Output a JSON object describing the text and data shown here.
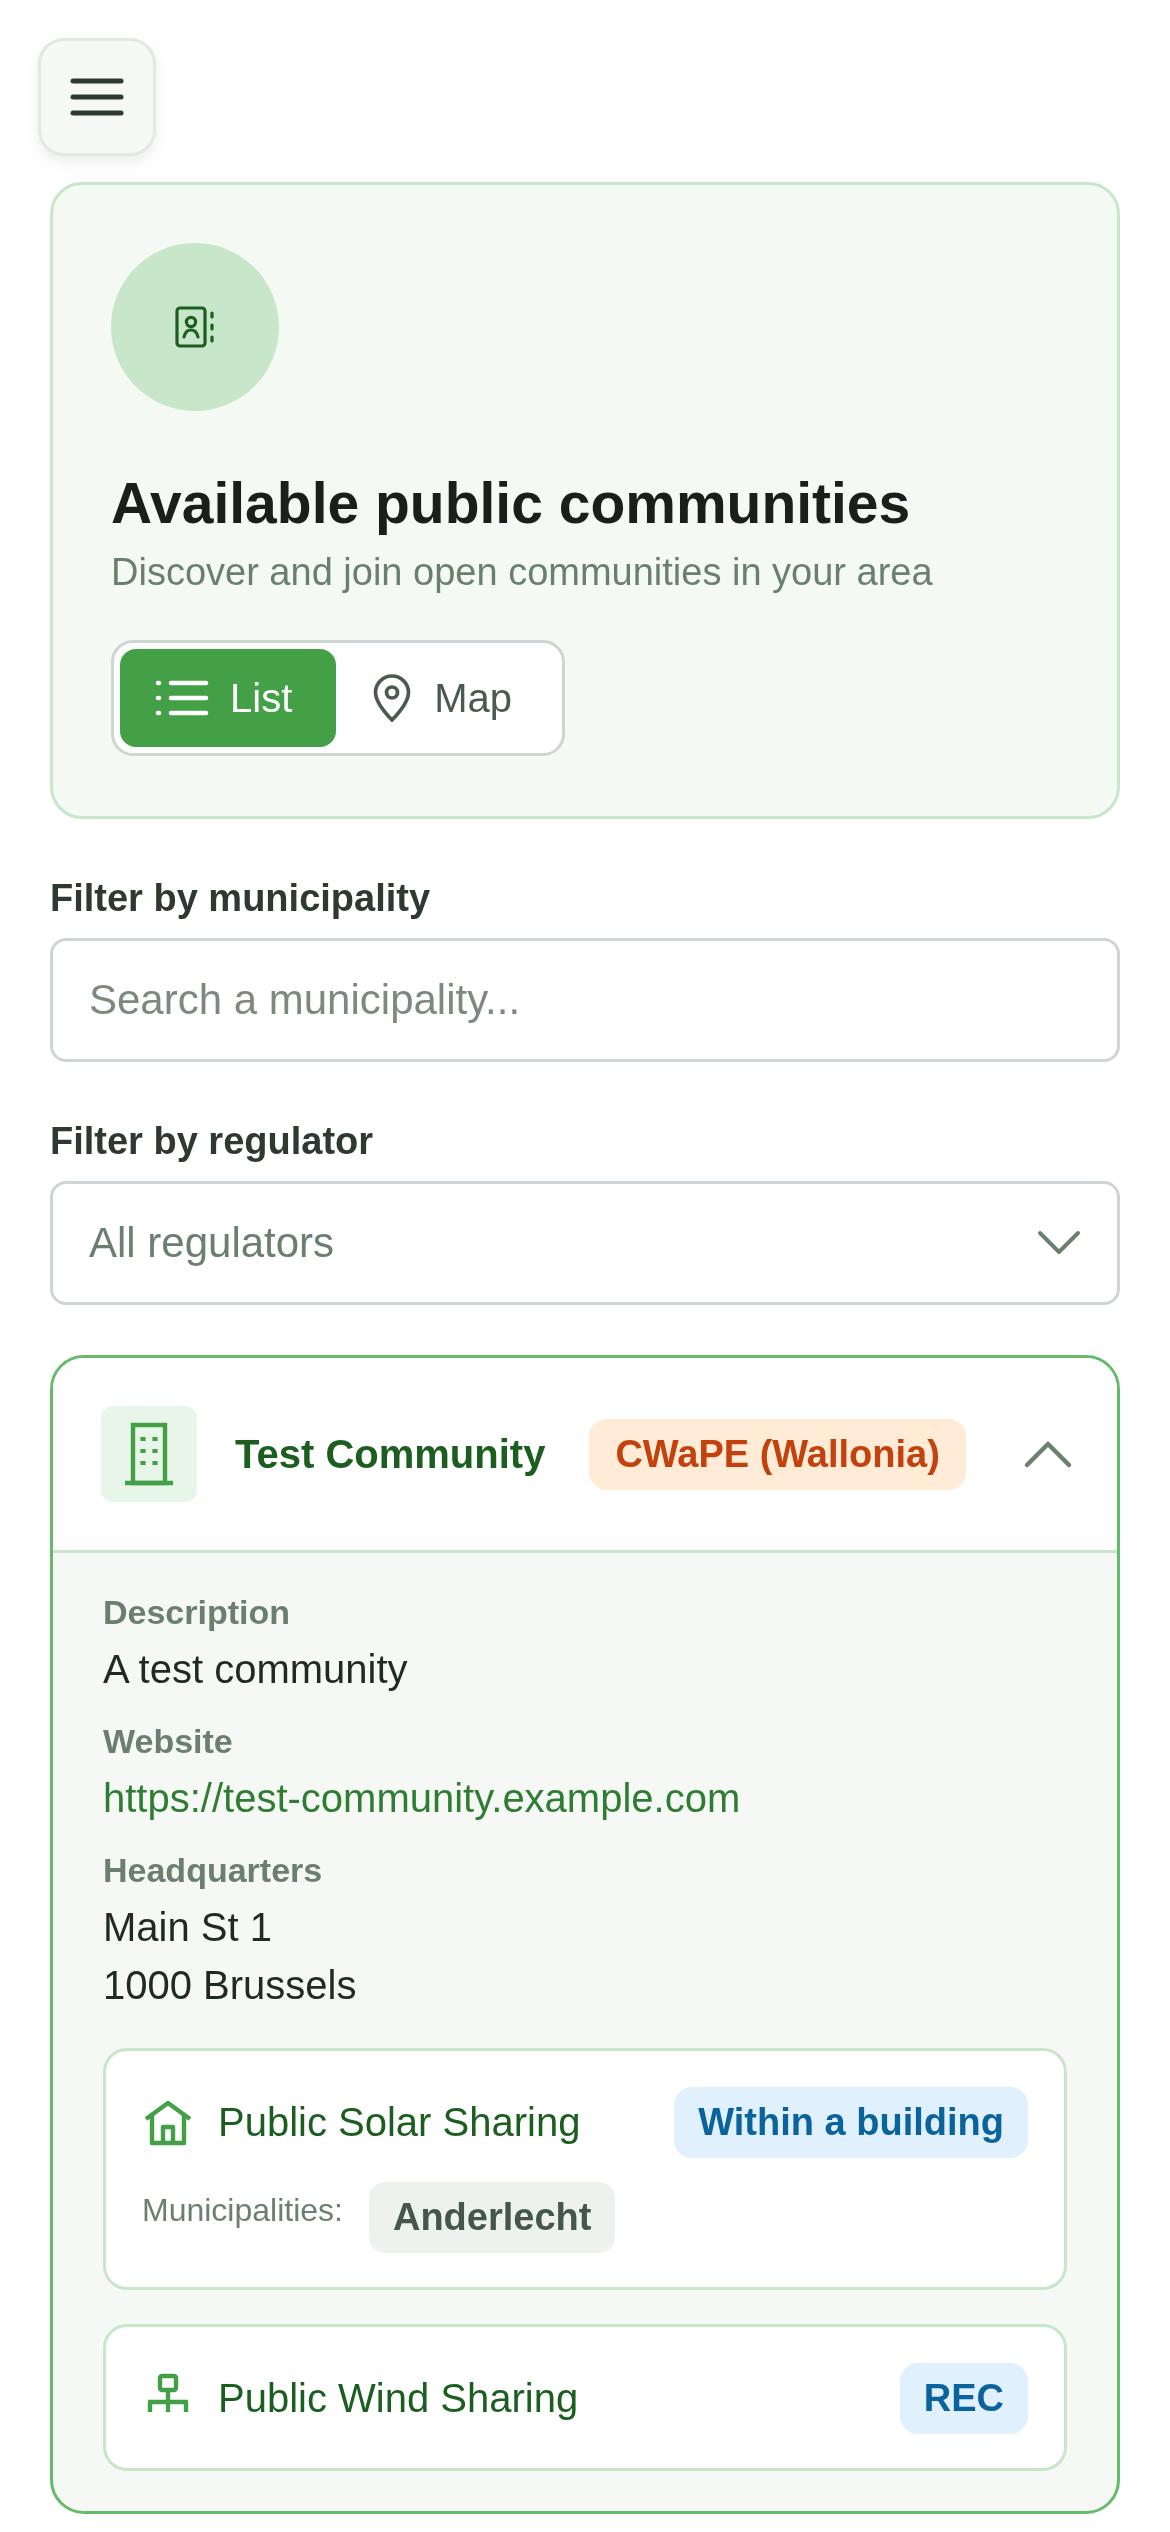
{
  "hero": {
    "title": "Available public communities",
    "subtitle": "Discover and join open communities in your area",
    "view_toggle": [
      {
        "label": "List",
        "selected": true
      },
      {
        "label": "Map",
        "selected": false
      }
    ]
  },
  "filters": [
    {
      "label": "Filter by municipality",
      "kind": "text",
      "placeholder": "Search a municipality..."
    },
    {
      "label": "Filter by regulator",
      "kind": "select",
      "value": "All regulators"
    }
  ],
  "communities": [
    {
      "name": "Test Community",
      "regulator": "CWaPE (Wallonia)",
      "expanded": true,
      "details": [
        {
          "label": "Description",
          "kind": "text",
          "lines": [
            "A test community"
          ]
        },
        {
          "label": "Website",
          "kind": "link",
          "lines": [
            "https://test-community.example.com"
          ]
        },
        {
          "label": "Headquarters",
          "kind": "text",
          "lines": [
            "Main St 1",
            "1000 Brussels"
          ]
        }
      ],
      "projects": [
        {
          "name": "Public Solar Sharing",
          "kind": "building",
          "badge": "Within a building",
          "municipalities_label": "Municipalities:",
          "municipalities": [
            "Anderlecht"
          ]
        },
        {
          "name": "Public Wind Sharing",
          "kind": "grid",
          "badge": "REC"
        }
      ]
    }
  ]
}
